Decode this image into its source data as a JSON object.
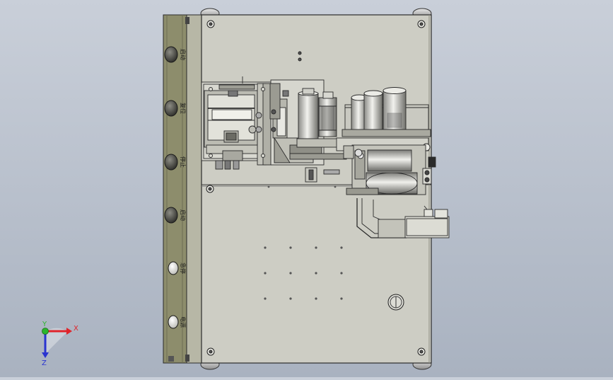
{
  "viewport": {
    "background_top": "#c9cfd9",
    "background_bottom": "#a9b2c0"
  },
  "machine": {
    "plate_color": "#cdcdc4",
    "side_panel_color": "#8d8d6c",
    "edge_color": "#2b2b2b"
  },
  "side_panel": {
    "buttons": [
      {
        "label": "启动",
        "style": "dark"
      },
      {
        "label": "复位",
        "style": "dark"
      },
      {
        "label": "停止",
        "style": "dark"
      },
      {
        "label": "启动",
        "style": "dark"
      },
      {
        "label": "急停",
        "style": "light"
      },
      {
        "label": "电源",
        "style": "light"
      }
    ]
  },
  "triad": {
    "x_label": "X",
    "y_label": "Y",
    "z_label": "Z",
    "x_color": "#e0242b",
    "y_color": "#2bb52b",
    "z_color": "#2a34d0"
  }
}
